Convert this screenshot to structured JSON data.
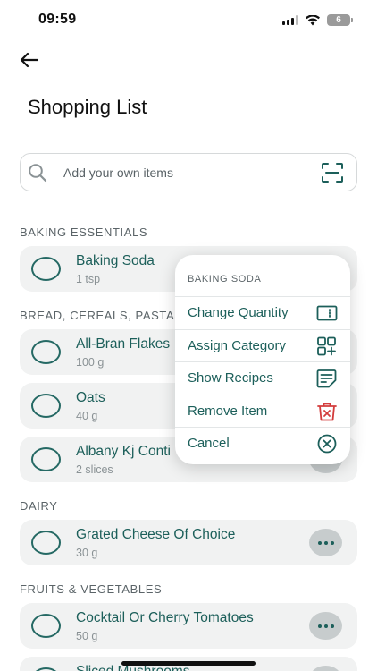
{
  "status": {
    "time": "09:59",
    "battery": "6"
  },
  "page": {
    "title": "Shopping List"
  },
  "search": {
    "placeholder": "Add your own items"
  },
  "sections": [
    {
      "header": "BAKING ESSENTIALS",
      "items": [
        {
          "name": "Baking Soda",
          "qty": "1 tsp"
        }
      ]
    },
    {
      "header": "BREAD, CEREALS, PASTAS",
      "items": [
        {
          "name": "All-Bran Flakes",
          "qty": "100 g"
        },
        {
          "name": "Oats",
          "qty": "40 g"
        },
        {
          "name": "Albany Kj Conti",
          "qty": "2 slices"
        }
      ]
    },
    {
      "header": "DAIRY",
      "items": [
        {
          "name": "Grated Cheese Of Choice",
          "qty": "30 g"
        }
      ]
    },
    {
      "header": "FRUITS & VEGETABLES",
      "items": [
        {
          "name": "Cocktail Or Cherry Tomatoes",
          "qty": "50 g"
        },
        {
          "name": "Sliced Mushrooms",
          "qty": ""
        }
      ]
    }
  ],
  "context_menu": {
    "title": "BAKING SODA",
    "items": [
      {
        "label": "Change Quantity",
        "icon": "quantity-icon"
      },
      {
        "label": "Assign Category",
        "icon": "category-icon"
      },
      {
        "label": "Show Recipes",
        "icon": "recipes-icon"
      },
      {
        "label": "Remove Item",
        "icon": "trash-icon"
      },
      {
        "label": "Cancel",
        "icon": "cancel-icon"
      }
    ]
  },
  "colors": {
    "accent": "#1c5f5a",
    "danger": "#d33c3c",
    "card": "#f1f2f2"
  }
}
